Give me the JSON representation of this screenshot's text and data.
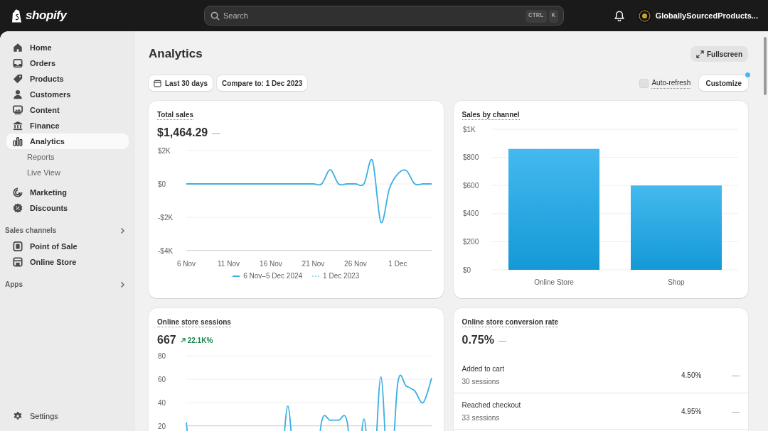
{
  "topbar": {
    "logo": "shopify",
    "search": {
      "placeholder": "Search",
      "shortcut": [
        "CTRL",
        "K"
      ]
    },
    "store_name": "GloballySourcedProducts..."
  },
  "sidebar": {
    "items": [
      {
        "label": "Home",
        "selected": false
      },
      {
        "label": "Orders",
        "selected": false
      },
      {
        "label": "Products",
        "selected": false
      },
      {
        "label": "Customers",
        "selected": false
      },
      {
        "label": "Content",
        "selected": false
      },
      {
        "label": "Finance",
        "selected": false
      },
      {
        "label": "Analytics",
        "selected": true,
        "children": [
          {
            "label": "Reports",
            "selected": false
          },
          {
            "label": "Live View",
            "selected": false
          }
        ]
      },
      {
        "label": "Marketing",
        "selected": false
      },
      {
        "label": "Discounts",
        "selected": false
      }
    ],
    "sections": [
      {
        "title": "Sales channels",
        "items": [
          {
            "label": "Point of Sale",
            "selected": false
          },
          {
            "label": "Online Store",
            "selected": false
          }
        ]
      },
      {
        "title": "Apps"
      }
    ],
    "settings": "Settings"
  },
  "page": {
    "title": "Analytics",
    "fullscreen_button": "Fullscreen",
    "date_range": "Last 30 days",
    "compare": "Compare to: 1 Dec 2023",
    "auto_refresh": {
      "label": "Auto-refresh",
      "checked": false
    },
    "customize": {
      "label": "Customize",
      "notification": true
    }
  },
  "cards": [
    {
      "kind": "line",
      "title": "Total sales",
      "value": "$1,464.29",
      "change": "—",
      "chart_data": {
        "type": "line",
        "grid": true,
        "categories": [
          "6 Nov",
          null,
          null,
          null,
          null,
          "11 Nov",
          null,
          null,
          null,
          null,
          "16 Nov",
          null,
          null,
          null,
          null,
          "21 Nov",
          null,
          null,
          null,
          null,
          "26 Nov",
          null,
          null,
          null,
          null,
          "1 Dec",
          null,
          null,
          null,
          null
        ],
        "series": [
          {
            "name": "6 Nov–5 Dec 2024",
            "color": "#3bb0e0",
            "values": [
              0,
              0,
              0,
              0,
              0,
              0,
              0,
              0,
              0,
              0,
              0,
              0,
              0,
              0,
              0,
              0,
              0,
              850,
              0,
              0,
              0,
              0,
              1400,
              -2300,
              -300,
              600,
              800,
              0,
              0,
              0
            ]
          },
          {
            "name": "1 Dec 2023",
            "color": "#9fd8ef",
            "values": [
              null,
              null,
              null,
              null,
              null,
              null,
              null,
              null,
              null,
              null,
              null,
              null,
              null,
              null,
              null,
              null,
              null,
              null,
              null,
              null,
              null,
              null,
              null,
              null,
              null,
              null,
              null,
              null,
              null,
              null
            ]
          }
        ],
        "ylim": [
          -4000,
          2000
        ],
        "yticks": [
          {
            "value": 2000,
            "label": "$2K"
          },
          {
            "value": 0,
            "label": "$0"
          },
          {
            "value": -2000,
            "label": "-$2K"
          },
          {
            "value": -4000,
            "label": "-$4K"
          }
        ]
      }
    },
    {
      "kind": "bar",
      "title": "Sales by channel",
      "chart_data": {
        "type": "bar",
        "grid": true,
        "categories": [
          "Online Store",
          "Shop"
        ],
        "values": [
          860,
          600
        ],
        "ylim": [
          0,
          1000
        ],
        "yticks": [
          {
            "value": 0,
            "label": "$0"
          },
          {
            "value": 200,
            "label": "$200"
          },
          {
            "value": 400,
            "label": "$400"
          },
          {
            "value": 600,
            "label": "$600"
          },
          {
            "value": 800,
            "label": "$800"
          },
          {
            "value": 1000,
            "label": "$1K"
          }
        ]
      }
    },
    {
      "kind": "line",
      "title": "Online store sessions",
      "value": "667",
      "change": "22.1K%",
      "positive": true,
      "chart_data": {
        "type": "line",
        "grid": true,
        "categories": [
          null,
          null,
          null,
          null,
          null,
          null,
          null,
          null,
          null,
          null,
          null,
          null,
          null,
          null,
          null,
          null,
          null,
          null,
          null,
          null,
          null,
          null,
          null,
          null,
          null,
          null,
          null,
          null,
          null,
          null
        ],
        "series": [
          {
            "color": "#3bb0e0",
            "values": [
              23,
              null,
              null,
              null,
              null,
              null,
              null,
              null,
              null,
              null,
              null,
              null,
              37,
              null,
              null,
              null,
              24,
              25,
              25,
              24,
              null,
              26,
              null,
              62,
              null,
              57,
              54,
              50,
              40,
              61
            ]
          }
        ],
        "ylim": [
          20,
          80
        ],
        "yticks": [
          {
            "value": 80,
            "label": "80"
          },
          {
            "value": 60,
            "label": "60"
          },
          {
            "value": 40,
            "label": "40"
          },
          {
            "value": 20,
            "label": "20"
          }
        ]
      }
    },
    {
      "kind": "funnel",
      "title": "Online store conversion rate",
      "value": "0.75%",
      "change": "—",
      "rows": [
        {
          "label": "Added to cart",
          "sessions": "30 sessions",
          "rate": "4.50%",
          "change": "—"
        },
        {
          "label": "Reached checkout",
          "sessions": "33 sessions",
          "rate": "4.95%",
          "change": "—"
        }
      ]
    }
  ]
}
